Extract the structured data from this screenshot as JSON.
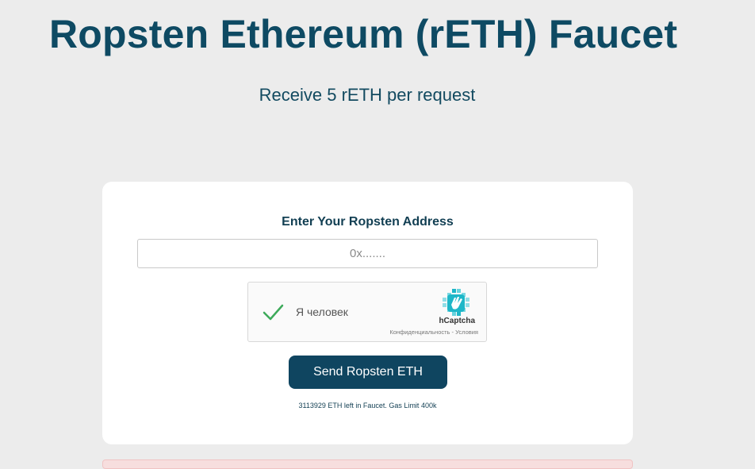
{
  "page": {
    "title": "Ropsten Ethereum (rETH) Faucet",
    "subtitle": "Receive 5 rETH per request"
  },
  "form": {
    "label": "Enter Your Ropsten Address",
    "address_placeholder": "0x.......",
    "address_value": "",
    "send_label": "Send Ropsten ETH",
    "footer_note": "3113929 ETH left in Faucet. Gas Limit 400k"
  },
  "captcha": {
    "label": "Я человек",
    "brand": "hCaptcha",
    "links": "Конфиденциальность - Условия",
    "checked": true,
    "check_icon": "checkmark-icon",
    "logo_icon": "hcaptcha-logo-icon"
  },
  "colors": {
    "heading": "#0e4a63",
    "button_bg": "#0f4560",
    "button_text": "#ffffff",
    "page_bg": "#ececec",
    "card_bg": "#ffffff",
    "check": "#3daa5a",
    "captcha_logo": "#1eb7c8"
  }
}
